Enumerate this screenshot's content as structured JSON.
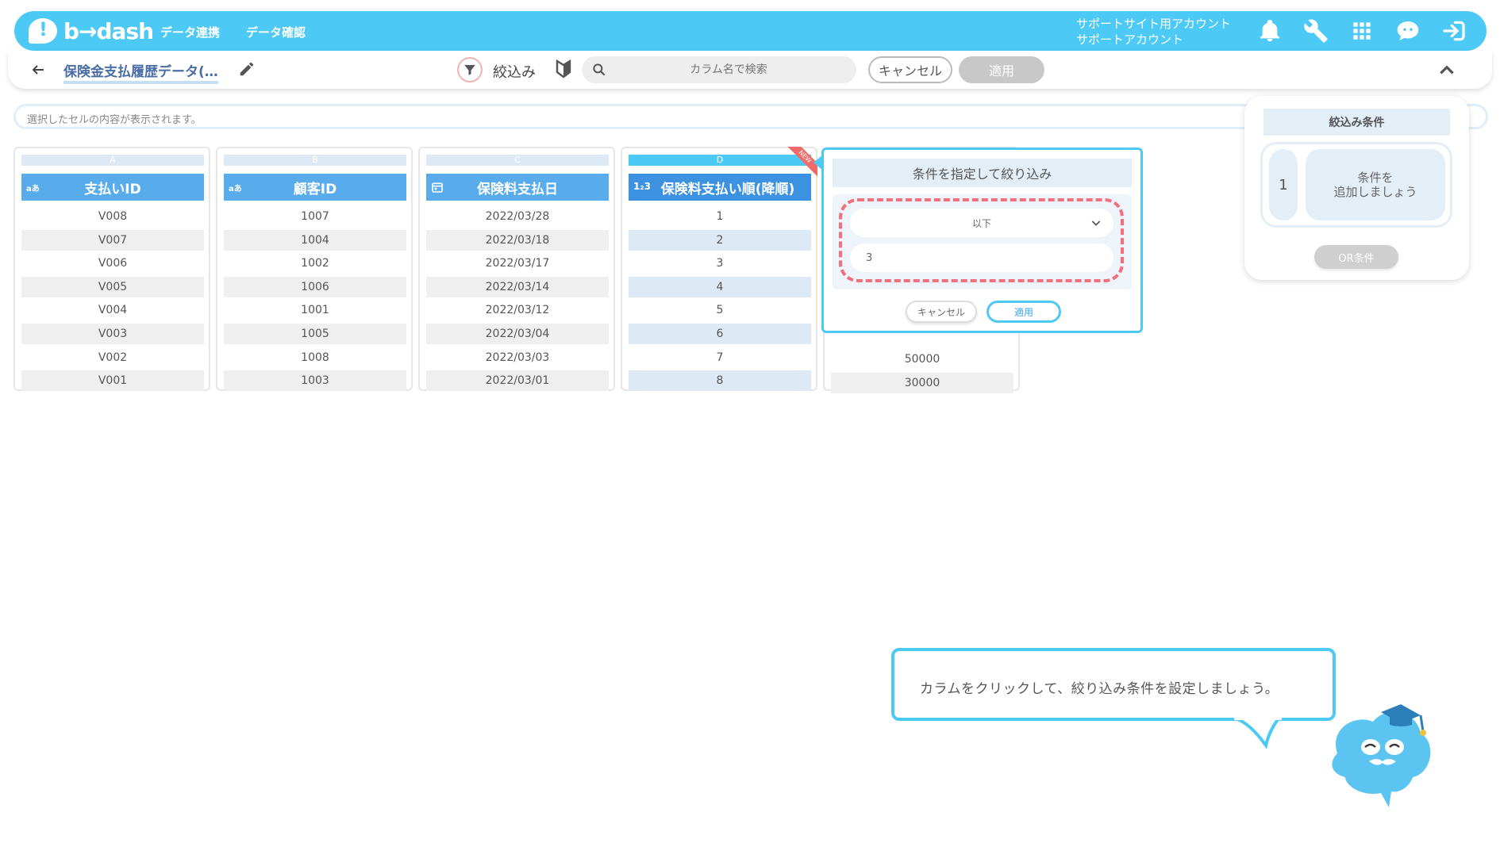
{
  "topbar": {
    "logo": "b→dash",
    "nav": [
      "データ連携",
      "データ確認"
    ],
    "account_line1": "サポートサイト用アカウント",
    "account_line2": "サポートアカウント",
    "icons": [
      "bell-icon",
      "wrench-icon",
      "apps-grid-icon",
      "support-chat-icon",
      "logout-icon"
    ]
  },
  "subheader": {
    "title": "保険金支払履歴データ(…",
    "filter_label": "絞込み",
    "search_placeholder": "カラム名で検索",
    "cancel_label": "キャンセル",
    "apply_label": "適用"
  },
  "cellbar": {
    "placeholder": "選択したセルの内容が表示されます。"
  },
  "columns": [
    {
      "letter": "A",
      "name": "支払いID",
      "type": "aあ",
      "values": [
        "V008",
        "V007",
        "V006",
        "V005",
        "V004",
        "V003",
        "V002",
        "V001"
      ]
    },
    {
      "letter": "B",
      "name": "顧客ID",
      "type": "aあ",
      "values": [
        "1007",
        "1004",
        "1002",
        "1006",
        "1001",
        "1005",
        "1008",
        "1003"
      ]
    },
    {
      "letter": "C",
      "name": "保険料支払日",
      "type": "calendar-icon",
      "values": [
        "2022/03/28",
        "2022/03/18",
        "2022/03/17",
        "2022/03/14",
        "2022/03/12",
        "2022/03/04",
        "2022/03/03",
        "2022/03/01"
      ]
    },
    {
      "letter": "D",
      "name": "保険料支払い順(降順)",
      "type": "1₂3",
      "badge": "NEW",
      "values": [
        "1",
        "2",
        "3",
        "4",
        "5",
        "6",
        "7",
        "8"
      ]
    },
    {
      "letter": "",
      "name": "",
      "type": "",
      "values": [
        "50000",
        "30000"
      ]
    }
  ],
  "popover": {
    "title": "条件を指定して絞り込み",
    "operator": "以下",
    "value": "3",
    "cancel_label": "キャンセル",
    "apply_label": "適用"
  },
  "rpanel": {
    "title": "絞込み条件",
    "group_number": "1",
    "add_line1": "条件を",
    "add_line2": "追加しましょう",
    "or_label": "OR条件"
  },
  "guide": {
    "text": "カラムをクリックして、絞り込み条件を設定しましょう。"
  },
  "colors": {
    "primary": "#4ccaf5",
    "header_blue": "#59acec",
    "highlight_red": "#f0717d"
  }
}
